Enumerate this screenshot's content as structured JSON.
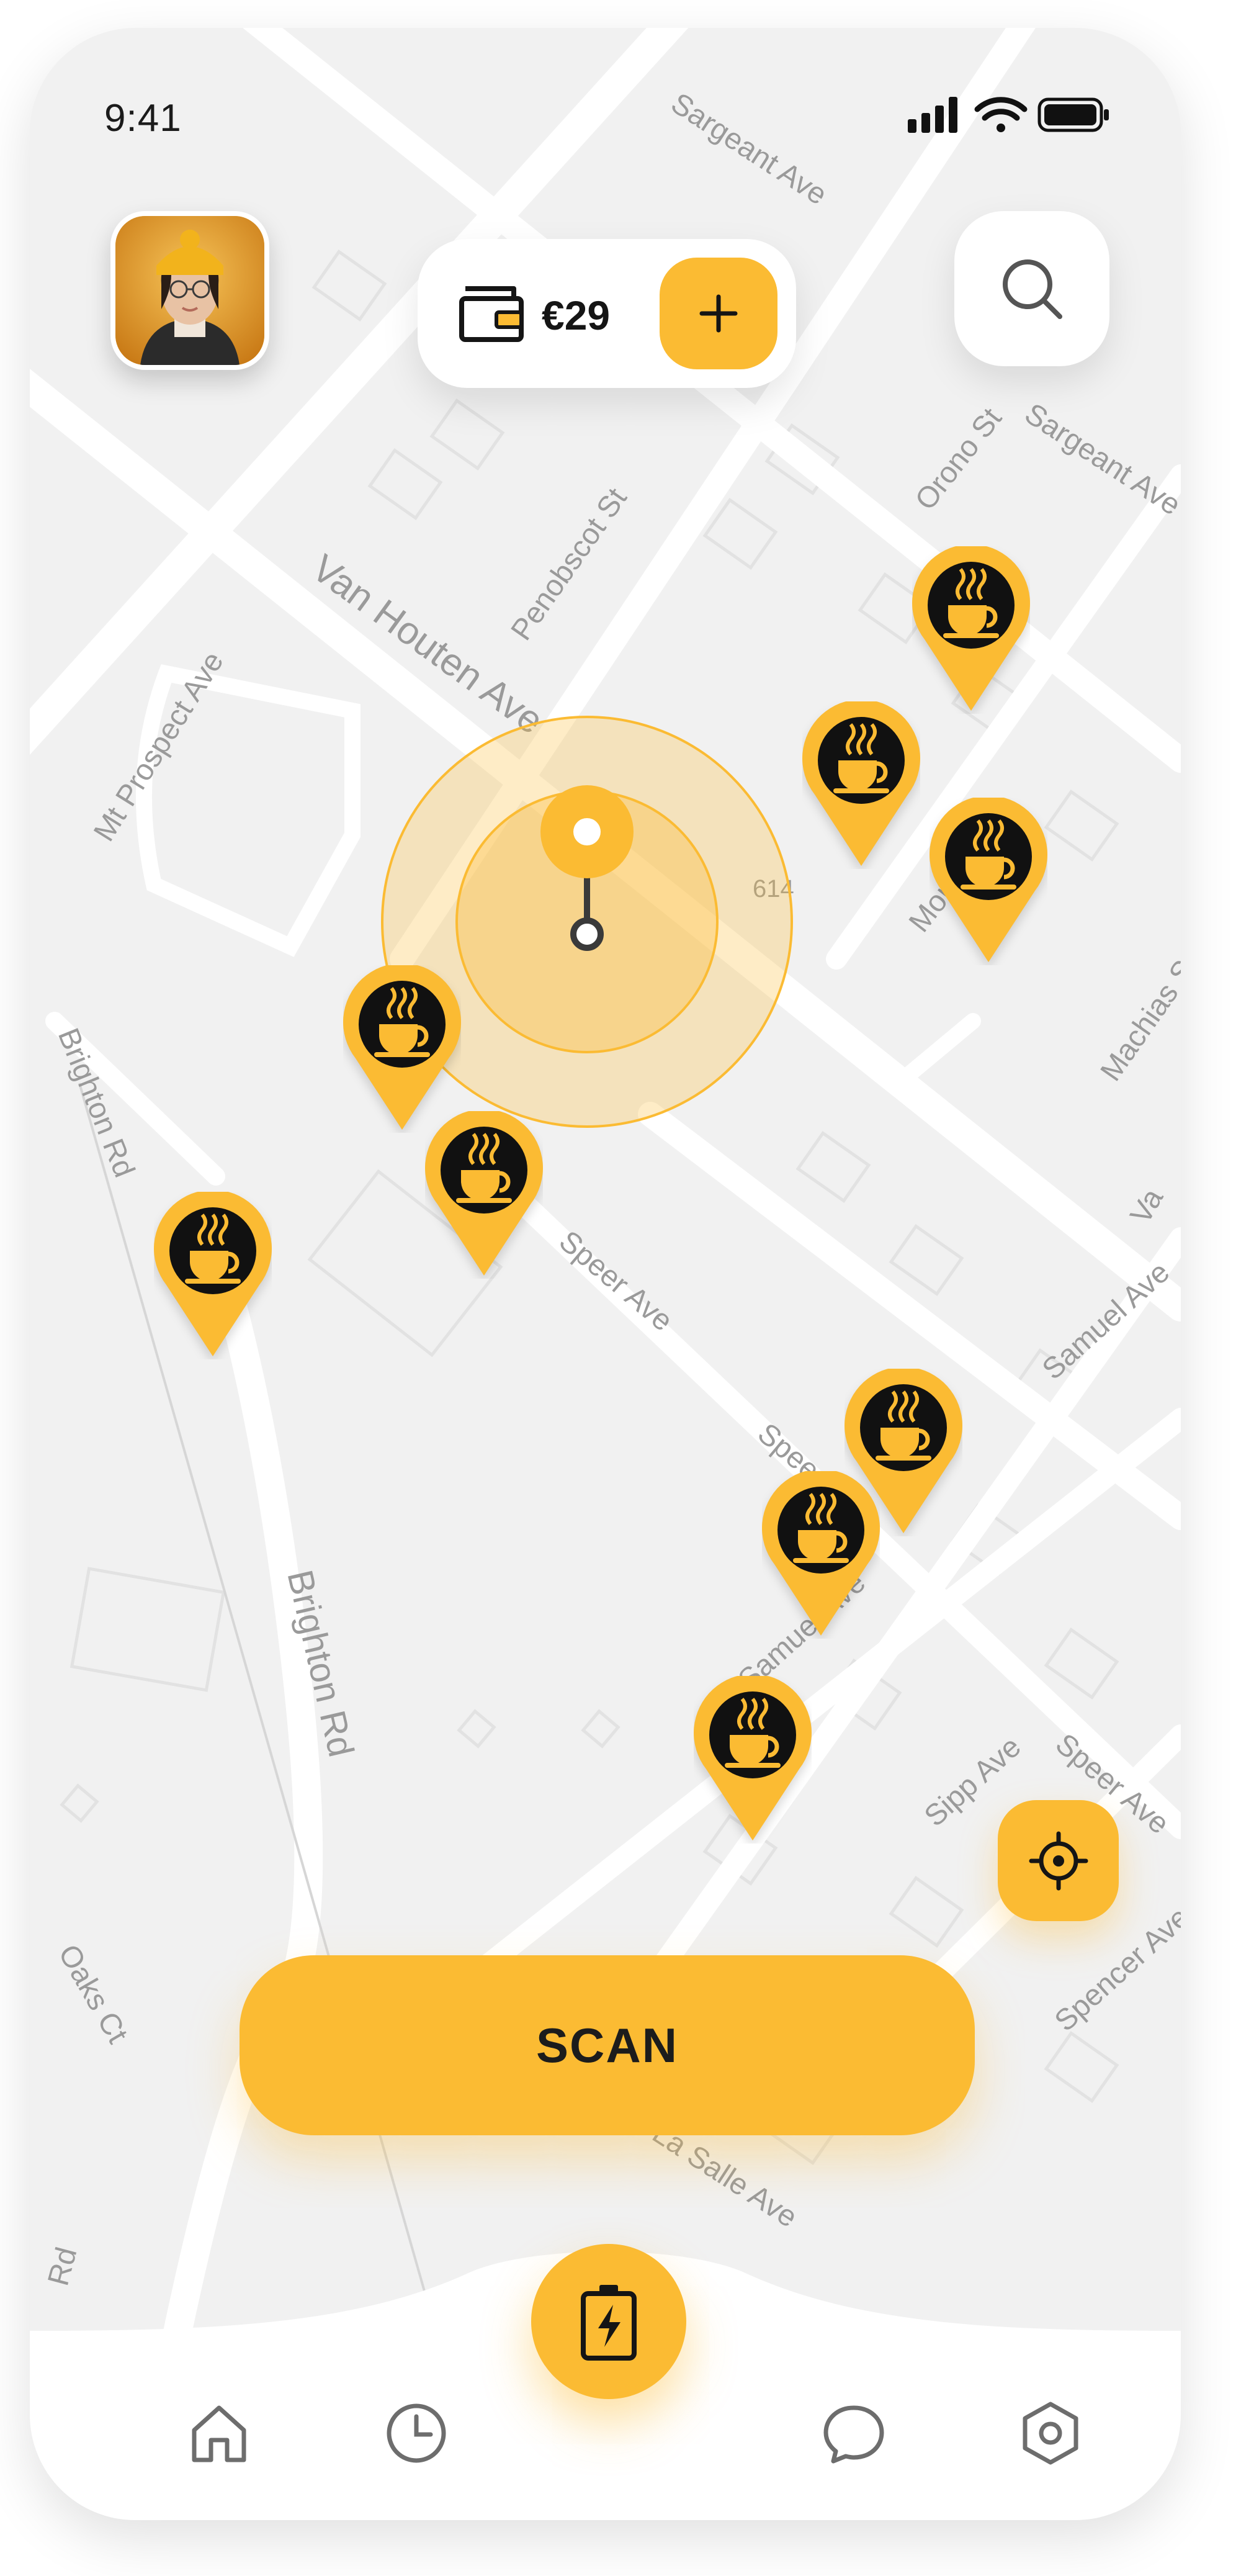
{
  "status_bar": {
    "time": "9:41"
  },
  "wallet": {
    "balance": "€29",
    "add_icon": "plus-icon",
    "wallet_icon": "wallet-icon"
  },
  "search": {
    "icon": "search-icon"
  },
  "map": {
    "streets": [
      "Mt Prospect Ave",
      "Sargeant Ave",
      "Sargeant Ave",
      "Van Houten Ave",
      "Penobscot St",
      "Orono St",
      "Brighton Rd",
      "Brighton Rd",
      "Speer Ave",
      "Speer Ave",
      "Samuel Ave",
      "Samuel Ave",
      "Sipp Ave",
      "Speer Ave",
      "Spencer Ave",
      "Machias St",
      "La Salle Ave",
      "Oaks Ct",
      "614",
      "Monhe St",
      "Va",
      "Rd"
    ],
    "pin_icon": "coffee-cup-icon",
    "pin_count": 10,
    "accent_color": "#fbbb33"
  },
  "actions": {
    "scan_label": "SCAN",
    "locate_icon": "crosshair-icon"
  },
  "nav": {
    "items": [
      {
        "icon": "home-icon"
      },
      {
        "icon": "history-clock-icon"
      },
      {
        "icon": "battery-charge-icon"
      },
      {
        "icon": "chat-bubble-icon"
      },
      {
        "icon": "settings-hexagon-icon"
      }
    ]
  }
}
